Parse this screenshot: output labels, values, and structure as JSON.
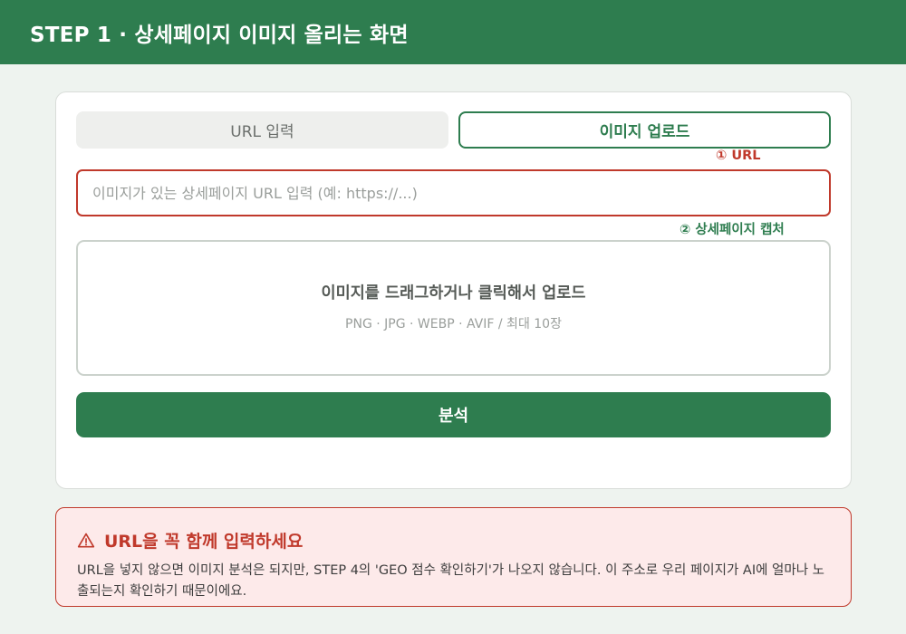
{
  "header": {
    "title": "STEP 1 · 상세페이지 이미지 올리는 화면"
  },
  "tabs": {
    "url_label": "URL 입력",
    "upload_label": "이미지 업로드"
  },
  "callouts": {
    "first": "① URL",
    "second": "② 상세페이지 캡처"
  },
  "url_input": {
    "value": "",
    "placeholder": "이미지가 있는 상세페이지 URL 입력 (예: https://...)"
  },
  "dropzone": {
    "main_text": "이미지를 드래그하거나 클릭해서 업로드",
    "sub_text": "PNG · JPG · WEBP · AVIF / 최대 10장"
  },
  "analyze_button": {
    "label": "분석"
  },
  "warning": {
    "icon": "warning-triangle-icon",
    "title": "URL을 꼭 함께 입력하세요",
    "body": "URL을 넣지 않으면 이미지 분석은 되지만, STEP 4의 'GEO 점수 확인하기'가 나오지 않습니다. 이 주소로 우리 페이지가 AI에 얼마나 노출되는지 확인하기 때문이에요."
  },
  "colors": {
    "primary": "#2e7d4f",
    "danger": "#c0392b",
    "background": "#eef3ef",
    "warning_bg": "#fdeaea"
  }
}
